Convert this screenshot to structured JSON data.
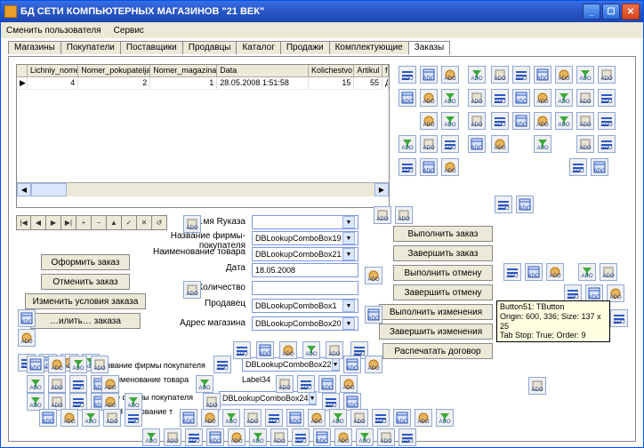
{
  "titlebar": {
    "app_glyph": "7",
    "title": "БД СЕТИ КОМПЬЮТЕРНЫХ МАГАЗИНОВ \"21 ВЕК\""
  },
  "menubar": {
    "items": [
      "Сменить пользователя",
      "Сервис"
    ]
  },
  "tabs": {
    "items": [
      "Магазины",
      "Покупатели",
      "Поставщики",
      "Продавцы",
      "Каталог",
      "Продажи",
      "Комплектующие",
      "Заказы"
    ],
    "active": 7
  },
  "grid": {
    "columns": [
      "Lichniy_nomer",
      "Nomer_pokupatelja",
      "Nomer_magazina",
      "Data",
      "Kolichestvo",
      "Artikul",
      "firma"
    ],
    "rows": [
      {
        "marker": "▶",
        "vals": [
          "4",
          "2",
          "1",
          "28.05.2008 1:51:58",
          "15",
          "55",
          "ДВК"
        ]
      }
    ]
  },
  "navbar": {
    "glyphs": [
      "|◀",
      "◀",
      "▶",
      "▶|",
      "+",
      "−",
      "▲",
      "✓",
      "✕",
      "↺"
    ]
  },
  "form": {
    "labels": {
      "order_type": "…мя Ryказа",
      "buyer_firm": "Название фирмы-покупателя",
      "product": "Наименование товара",
      "date": "Дата",
      "qty": "Количество",
      "seller": "Продавец",
      "store_addr": "Адрес магазина"
    },
    "values": {
      "buyer_firm": "DBLookupComboBox19",
      "product": "DBLookupComboBox21",
      "date": "18.05.2008",
      "seller": "DBLookupComboBox1",
      "store_addr": "DBLookupComboBox20"
    }
  },
  "left_buttons": {
    "submit": "Оформить заказ",
    "cancel": "Отменить заказ",
    "edit_cond": "Изменить условия заказа",
    "del_cond": "…илить… заказа"
  },
  "right_buttons": {
    "do_order": "Выполнить заказ",
    "finish_order": "Завершить заказ",
    "do_cancel": "Выполнить отмену",
    "finish_cancel": "Завершить отмену",
    "do_changes": "Выполнить изменения",
    "finish_changes": "Завершить изменения",
    "print": "Распечатать договор"
  },
  "tooltip": {
    "line1": "Button51: TButton",
    "line2": "Origin: 600, 336; Size: 137 x 25",
    "line3": "Tab Stop: True; Order: 9"
  },
  "extra_labels": {
    "firm_buyer2": "звание фирмы покупателя",
    "product2": "именование товара",
    "value2": "Label34",
    "firm_buyer3": "е фирмы покупателя",
    "na": "На",
    "ovanie": "ювание т",
    "on": "о Н",
    "combo22": "DBLookupComboBox22",
    "combo24": "DBLookupComboBox24"
  },
  "colors": {
    "titlebar": "#2b59c9",
    "panel": "#ece9d8",
    "accent": "#1b3f9b"
  }
}
